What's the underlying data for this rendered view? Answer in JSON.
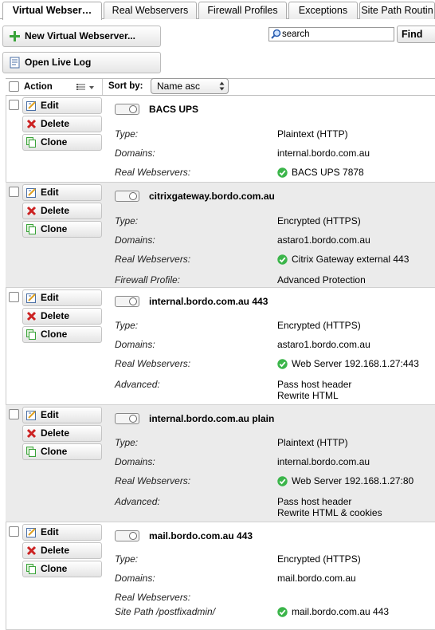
{
  "tabs": [
    {
      "label": "Virtual Webser…",
      "active": true
    },
    {
      "label": "Real Webservers",
      "active": false
    },
    {
      "label": "Firewall Profiles",
      "active": false
    },
    {
      "label": "Exceptions",
      "active": false
    },
    {
      "label": "Site Path Routin",
      "active": false
    }
  ],
  "toolbar": {
    "new_label": "New Virtual Webserver...",
    "live_log_label": "Open Live Log",
    "search_value": "search",
    "find_label": "Find"
  },
  "header": {
    "action_label": "Action",
    "sort_by_label": "Sort by:",
    "sort_value": "Name asc"
  },
  "buttons": {
    "edit": "Edit",
    "delete": "Delete",
    "clone": "Clone"
  },
  "colors": {
    "ok": "#3bb54a",
    "delete": "#cc2222",
    "add": "#39a339",
    "alt_row": "#ebebeb"
  },
  "servers": [
    {
      "name": "BACS UPS",
      "fields": [
        {
          "label": "Type:",
          "value": "Plaintext (HTTP)"
        },
        {
          "label": "Domains:",
          "value": "internal.bordo.com.au"
        },
        {
          "label": "Real Webservers:",
          "value": "BACS UPS 7878",
          "status": "ok"
        }
      ]
    },
    {
      "name": "citrixgateway.bordo.com.au",
      "fields": [
        {
          "label": "Type:",
          "value": "Encrypted (HTTPS)"
        },
        {
          "label": "Domains:",
          "value": "astaro1.bordo.com.au"
        },
        {
          "label": "Real Webservers:",
          "value": "Citrix Gateway external 443",
          "status": "ok"
        },
        {
          "label": "Firewall Profile:",
          "value": "Advanced Protection"
        }
      ]
    },
    {
      "name": "internal.bordo.com.au 443",
      "fields": [
        {
          "label": "Type:",
          "value": "Encrypted (HTTPS)"
        },
        {
          "label": "Domains:",
          "value": "astaro1.bordo.com.au"
        },
        {
          "label": "Real Webservers:",
          "value": "Web Server 192.168.1.27:443",
          "status": "ok"
        },
        {
          "label": "Advanced:",
          "value": "Pass host header",
          "value2": "Rewrite HTML"
        }
      ]
    },
    {
      "name": "internal.bordo.com.au plain",
      "fields": [
        {
          "label": "Type:",
          "value": "Plaintext (HTTP)"
        },
        {
          "label": "Domains:",
          "value": "internal.bordo.com.au"
        },
        {
          "label": "Real Webservers:",
          "value": "Web Server 192.168.1.27:80",
          "status": "ok"
        },
        {
          "label": "Advanced:",
          "value": "Pass host header",
          "value2": "Rewrite HTML & cookies"
        }
      ]
    },
    {
      "name": "mail.bordo.com.au 443",
      "fields": [
        {
          "label": "Type:",
          "value": "Encrypted (HTTPS)"
        },
        {
          "label": "Domains:",
          "value": "mail.bordo.com.au"
        },
        {
          "label": "Real Webservers:",
          "value": ""
        },
        {
          "label": "Site Path /postfixadmin/",
          "value": "mail.bordo.com.au 443",
          "status": "ok"
        }
      ]
    }
  ]
}
